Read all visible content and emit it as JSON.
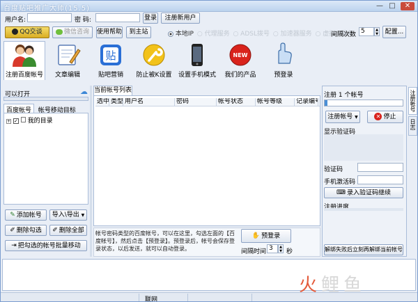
{
  "window": {
    "title": "百度贴吧推广大师(15.5)",
    "min": "—",
    "max": "□",
    "close": "✕"
  },
  "login": {
    "user_label": "用户名:",
    "pass_label": "密 码:",
    "login_btn": "登录",
    "register_btn": "注册新用户"
  },
  "actions": {
    "qq": "QQ交谈",
    "wechat": "微信咨询",
    "help": "使用帮助",
    "home": "到主站"
  },
  "net": {
    "local_ip": "本地IP",
    "opt2": "代理服务",
    "opt3": "ADSL拨号",
    "opt4": "加速器服务",
    "opt5": "虚拟IP服务",
    "interval_label": "间隔次数",
    "interval_value": "5",
    "config": "配置..."
  },
  "toolbar": [
    {
      "label": "注册百度帐号",
      "icon": "users-icon"
    },
    {
      "label": "文章编辑",
      "icon": "notepad-icon"
    },
    {
      "label": "贴吧营销",
      "icon": "tieba-icon"
    },
    {
      "label": "防止被K设置",
      "icon": "wrench-icon"
    },
    {
      "label": "设置手机模式",
      "icon": "phone-icon"
    },
    {
      "label": "我们的产品",
      "icon": "new-badge-icon"
    },
    {
      "label": "预登录",
      "icon": "hand-icon"
    }
  ],
  "left": {
    "title": "可以打开",
    "tab1": "百度帐号",
    "tab2": "帐号移动目标",
    "tree_item": "我的目录",
    "add": "添加帐号",
    "io": "导入\\导出",
    "del_checked": "删除勾选",
    "del_all": "删除全部",
    "batch_move": "把勾选的帐号批量移动"
  },
  "center": {
    "tab": "当前帐号列表",
    "columns": [
      "选中",
      "类型",
      "用户名",
      "密码",
      "帐号状态",
      "帐号等级",
      "记录编号"
    ],
    "note": "帐号密码类型的百度帐号，可以在这里，勾选左面的【百度帐号】，然后点击【预登录】。预登录后，帐号会保存登录状态，以后发送，就可以自动登录。",
    "prelogin": "预登录",
    "interval_label": "间隔时间",
    "interval_value": "3",
    "sec": "秒"
  },
  "right": {
    "title": "注册 1 个帐号",
    "register": "注册帐号",
    "stop": "停止",
    "captcha_label": "显示验证码",
    "code_label": "验证码",
    "phone_label": "手机激活码",
    "enter_code": "录入验证码继续",
    "progress_label": "注册进度",
    "unbind": "解绑失败后立刻再解绑当前帐号"
  },
  "side_tabs": [
    "注册帐号",
    "日志"
  ],
  "status": {
    "net": "联网"
  },
  "watermark": "火鲤鱼"
}
